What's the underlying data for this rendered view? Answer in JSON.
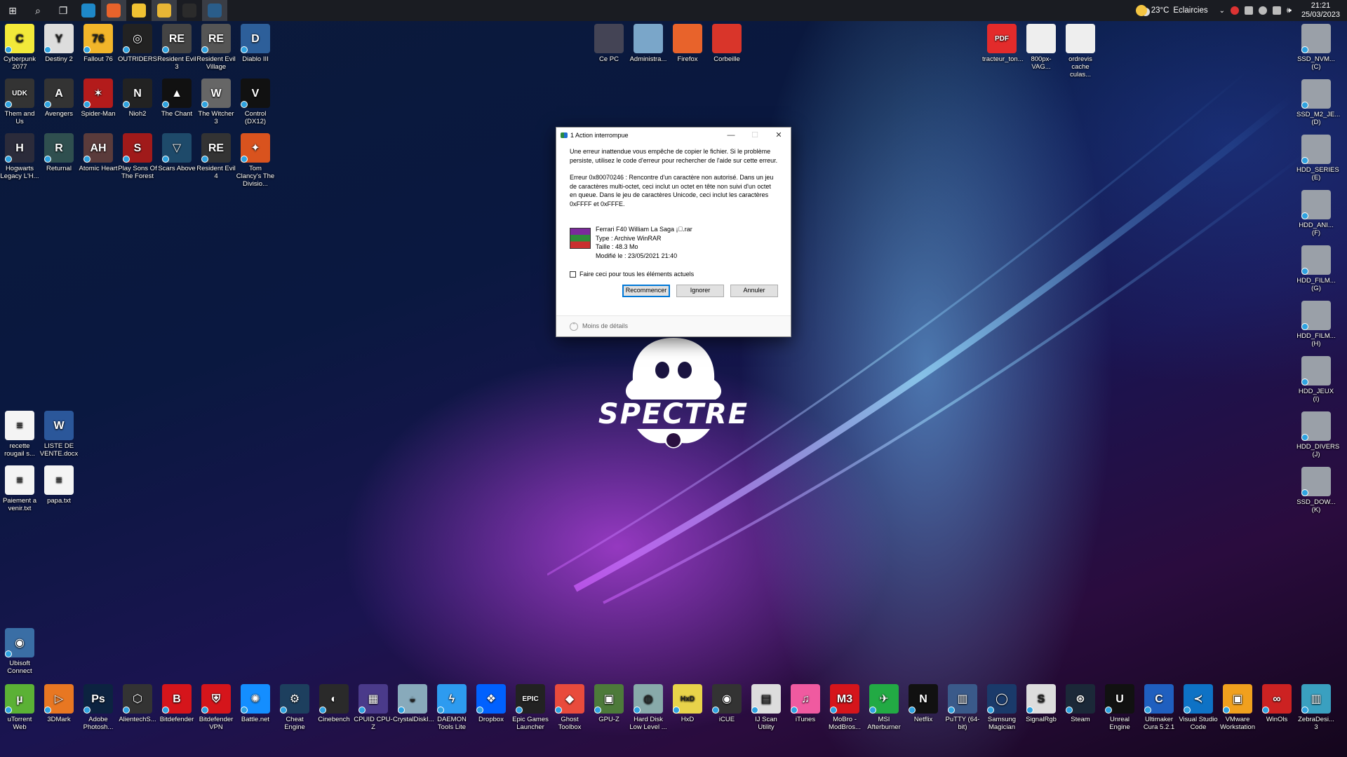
{
  "taskbar": {
    "start": "⊞",
    "search": "⌕",
    "taskview": "❐",
    "apps": [
      {
        "name": "edge",
        "color": "#1e88c8",
        "active": false
      },
      {
        "name": "firefox",
        "color": "#e8632b",
        "active": true
      },
      {
        "name": "explorer",
        "color": "#f1c232",
        "active": false
      },
      {
        "name": "file-explorer-2",
        "color": "#e8b635",
        "active": true
      },
      {
        "name": "terminal",
        "color": "#2b2b2b",
        "active": false
      },
      {
        "name": "app-c",
        "color": "#2a5d8a",
        "active": true
      }
    ],
    "weather": {
      "temp": "23°C",
      "label": "Eclaircies"
    },
    "clock": {
      "time": "21:21",
      "date": "25/03/2023"
    }
  },
  "desktop": {
    "games": [
      {
        "label": "Cyberpunk 2077",
        "color": "#f2e93a",
        "glyph": "C"
      },
      {
        "label": "Destiny 2",
        "color": "#ddd",
        "glyph": "Y"
      },
      {
        "label": "Fallout 76",
        "color": "#f2b52a",
        "glyph": "76"
      },
      {
        "label": "OUTRIDERS",
        "color": "#222",
        "glyph": "◎"
      },
      {
        "label": "Resident Evil 3",
        "color": "#444",
        "glyph": "RE"
      },
      {
        "label": "Resident Evil Village",
        "color": "#555",
        "glyph": "RE"
      },
      {
        "label": "Diablo III",
        "color": "#2d5f9a",
        "glyph": "D"
      },
      {
        "label": "Them and Us",
        "color": "#333",
        "glyph": "UDK"
      },
      {
        "label": "Avengers",
        "color": "#333",
        "glyph": "A"
      },
      {
        "label": "Spider-Man",
        "color": "#b31b1b",
        "glyph": "✶"
      },
      {
        "label": "Nioh2",
        "color": "#222",
        "glyph": "N"
      },
      {
        "label": "The Chant",
        "color": "#111",
        "glyph": "▲"
      },
      {
        "label": "The Witcher 3",
        "color": "#666",
        "glyph": "W"
      },
      {
        "label": "Control (DX12)",
        "color": "#111",
        "glyph": "V"
      },
      {
        "label": "Hogwarts Legacy  L'H...",
        "color": "#2b2b3a",
        "glyph": "H"
      },
      {
        "label": "Returnal",
        "color": "#2f4f4f",
        "glyph": "R"
      },
      {
        "label": "Atomic Heart",
        "color": "#5a3b3b",
        "glyph": "AH"
      },
      {
        "label": "Play Sons Of The Forest",
        "color": "#a01a1a",
        "glyph": "S"
      },
      {
        "label": "Scars Above",
        "color": "#1e4a6a",
        "glyph": "▽"
      },
      {
        "label": "Resident Evil 4",
        "color": "#333",
        "glyph": "RE"
      },
      {
        "label": "Tom Clancy's The Divisio...",
        "color": "#d9531e",
        "glyph": "✦"
      }
    ],
    "center_icons": [
      {
        "label": "Ce PC",
        "color": "#445"
      },
      {
        "label": "Administra...",
        "color": "#7aa6c9"
      },
      {
        "label": "Firefox",
        "color": "#e8632b"
      },
      {
        "label": "Corbeille",
        "color": "#d9352a"
      }
    ],
    "top_right_files": [
      {
        "label": "tracteur_ton...",
        "color": "#e32b2b",
        "glyph": "PDF"
      },
      {
        "label": "800px-VAG...",
        "color": "#eee",
        "glyph": ""
      },
      {
        "label": "ordrevis cache culas...",
        "color": "#eee",
        "glyph": ""
      }
    ],
    "drives": [
      {
        "label": "SSD_NVM... (C)"
      },
      {
        "label": "SSD_M2_JE... (D)"
      },
      {
        "label": "HDD_SERIES (E)"
      },
      {
        "label": "HDD_ANI... (F)"
      },
      {
        "label": "HDD_FILM... (G)"
      },
      {
        "label": "HDD_FILM... (H)"
      },
      {
        "label": "HDD_JEUX (I)"
      },
      {
        "label": "HDD_DIVERS (J)"
      },
      {
        "label": "SSD_DOW... (K)"
      }
    ],
    "docs": [
      {
        "label": "recette rougail s...",
        "color": "#f4f4f4",
        "glyph": "≡"
      },
      {
        "label": "LISTE DE VENTE.docx",
        "color": "#2b579a",
        "glyph": "W"
      },
      {
        "label": "Paiement a venir.txt",
        "color": "#f4f4f4",
        "glyph": "≡"
      },
      {
        "label": "papa.txt",
        "color": "#f4f4f4",
        "glyph": "≡"
      }
    ],
    "ubisoft": {
      "label": "Ubisoft Connect",
      "color": "#3a6ea5",
      "glyph": "◉"
    },
    "bottom_apps": [
      {
        "label": "uTorrent Web",
        "color": "#5bb135",
        "glyph": "µ"
      },
      {
        "label": "3DMark",
        "color": "#e87722",
        "glyph": "▷"
      },
      {
        "label": "Adobe Photosh...",
        "color": "#0c2340",
        "glyph": "Ps"
      },
      {
        "label": "AlientechS...",
        "color": "#333",
        "glyph": "⬡"
      },
      {
        "label": "Bitdefender",
        "color": "#d5151b",
        "glyph": "B"
      },
      {
        "label": "Bitdefender VPN",
        "color": "#d5151b",
        "glyph": "⛨"
      },
      {
        "label": "Battle.net",
        "color": "#148eff",
        "glyph": "✺"
      },
      {
        "label": "Cheat Engine",
        "color": "#1d3f5e",
        "glyph": "⚙"
      },
      {
        "label": "Cinebench",
        "color": "#2a2a2a",
        "glyph": "◐"
      },
      {
        "label": "CPUID CPU-Z",
        "color": "#4a3a8a",
        "glyph": "▦"
      },
      {
        "label": "CrystalDiskI...",
        "color": "#8ab",
        "glyph": "◒"
      },
      {
        "label": "DAEMON Tools Lite",
        "color": "#2d9bf0",
        "glyph": "ϟ"
      },
      {
        "label": "Dropbox",
        "color": "#0061fe",
        "glyph": "❖"
      },
      {
        "label": "Epic Games Launcher",
        "color": "#222",
        "glyph": "EPIC"
      },
      {
        "label": "Ghost Toolbox",
        "color": "#e94b3c",
        "glyph": "◆"
      },
      {
        "label": "GPU-Z",
        "color": "#4d7a3a",
        "glyph": "▣"
      },
      {
        "label": "Hard Disk Low Level ...",
        "color": "#8aa",
        "glyph": "◍"
      },
      {
        "label": "HxD",
        "color": "#e8d34a",
        "glyph": "HxD"
      },
      {
        "label": "iCUE",
        "color": "#333",
        "glyph": "◉"
      },
      {
        "label": "IJ Scan Utility",
        "color": "#ddd",
        "glyph": "▤"
      },
      {
        "label": "iTunes",
        "color": "#f05aa0",
        "glyph": "♫"
      },
      {
        "label": "MoBro - ModBros...",
        "color": "#d5151b",
        "glyph": "M3"
      },
      {
        "label": "MSI Afterburner",
        "color": "#2a4",
        "glyph": "✈"
      },
      {
        "label": "Netflix",
        "color": "#111",
        "glyph": "N"
      },
      {
        "label": "PuTTY (64-bit)",
        "color": "#3a5a8a",
        "glyph": "▥"
      },
      {
        "label": "Samsung Magician",
        "color": "#1a3a6a",
        "glyph": "◯"
      },
      {
        "label": "SignalRgb",
        "color": "#ddd",
        "glyph": "S"
      },
      {
        "label": "Steam",
        "color": "#1b2838",
        "glyph": "⊛"
      },
      {
        "label": "Unreal Engine",
        "color": "#111",
        "glyph": "U"
      },
      {
        "label": "Ultimaker Cura 5.2.1",
        "color": "#1f5fbf",
        "glyph": "C"
      },
      {
        "label": "Visual Studio Code",
        "color": "#0e72c5",
        "glyph": "≺"
      },
      {
        "label": "VMware Workstation",
        "color": "#f0a01e",
        "glyph": "▣"
      },
      {
        "label": "WinOls",
        "color": "#c22",
        "glyph": "∞"
      },
      {
        "label": "ZebraDesi... 3",
        "color": "#3aa0c0",
        "glyph": "▥"
      }
    ]
  },
  "dialog": {
    "title": "1 Action interrompue",
    "message": "Une erreur inattendue vous empêche de copier le fichier. Si le problème persiste, utilisez le code d'erreur pour rechercher de l'aide sur cette erreur.",
    "error": "Erreur 0x80070246 : Rencontre d'un caractère non autorisé. Dans un jeu de caractères multi-octet, ceci inclut un octet en tête non suivi d'un octet en queue. Dans le jeu de caractères Unicode, ceci inclut les caractères 0xFFFF et 0xFFFE.",
    "file": {
      "name": "Ferrari F40 William La Saga ¡\u0000.rar",
      "type": "Type : Archive WinRAR",
      "size": "Taille : 48.3 Mo",
      "modified": "Modifié le : 23/05/2021 21:40"
    },
    "checkbox_label": "Faire ceci pour tous les éléments actuels",
    "buttons": {
      "retry": "Recommencer",
      "skip": "Ignorer",
      "cancel": "Annuler"
    },
    "footer": "Moins de détails"
  },
  "wallpaper": {
    "logo_text": "SPECTRE"
  }
}
